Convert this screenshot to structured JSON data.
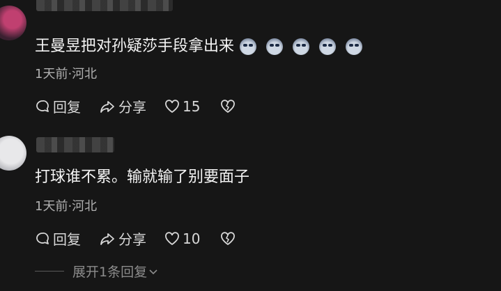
{
  "comments": [
    {
      "text": "王曼昱把对孙疑莎手段拿出来",
      "emoji_count": 5,
      "meta": "1天前·河北",
      "actions": {
        "reply": "回复",
        "share": "分享",
        "likes": "15"
      }
    },
    {
      "text": "打球谁不累。输就输了别要面子",
      "meta": "1天前·河北",
      "actions": {
        "reply": "回复",
        "share": "分享",
        "likes": "10"
      }
    }
  ],
  "expand_label": "展开1条回复",
  "icons": [
    "reply-icon",
    "share-icon",
    "heart-icon",
    "broken-heart-icon",
    "chevron-down-icon",
    "laughing-emoji-icon"
  ]
}
